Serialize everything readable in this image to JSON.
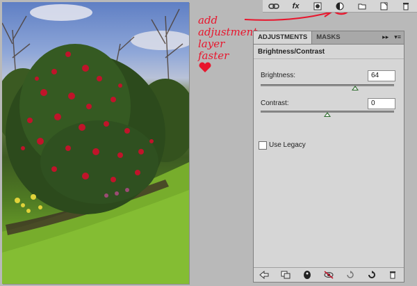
{
  "annotation": {
    "text": "add\nadjustment\nlayer\nfaster",
    "color": "#e8162d"
  },
  "layer_bar": {
    "icons": [
      "link-icon",
      "fx-icon",
      "mask-icon",
      "adjustment-layer-icon",
      "folder-icon",
      "new-layer-icon",
      "trash-icon"
    ],
    "fx_label": "fx"
  },
  "panel": {
    "tabs": [
      {
        "label": "ADJUSTMENTS",
        "active": true
      },
      {
        "label": "MASKS",
        "active": false
      }
    ],
    "title": "Brightness/Contrast",
    "brightness": {
      "label": "Brightness:",
      "value": "64",
      "slider_fraction": 0.71
    },
    "contrast": {
      "label": "Contrast:",
      "value": "0",
      "slider_fraction": 0.5
    },
    "use_legacy": {
      "label": "Use Legacy",
      "checked": false
    },
    "footer_icons": [
      "back-arrow-icon",
      "clip-to-layer-icon",
      "visibility-eye-icon",
      "view-previous-icon",
      "reset-icon",
      "refresh-icon",
      "delete-icon"
    ]
  }
}
